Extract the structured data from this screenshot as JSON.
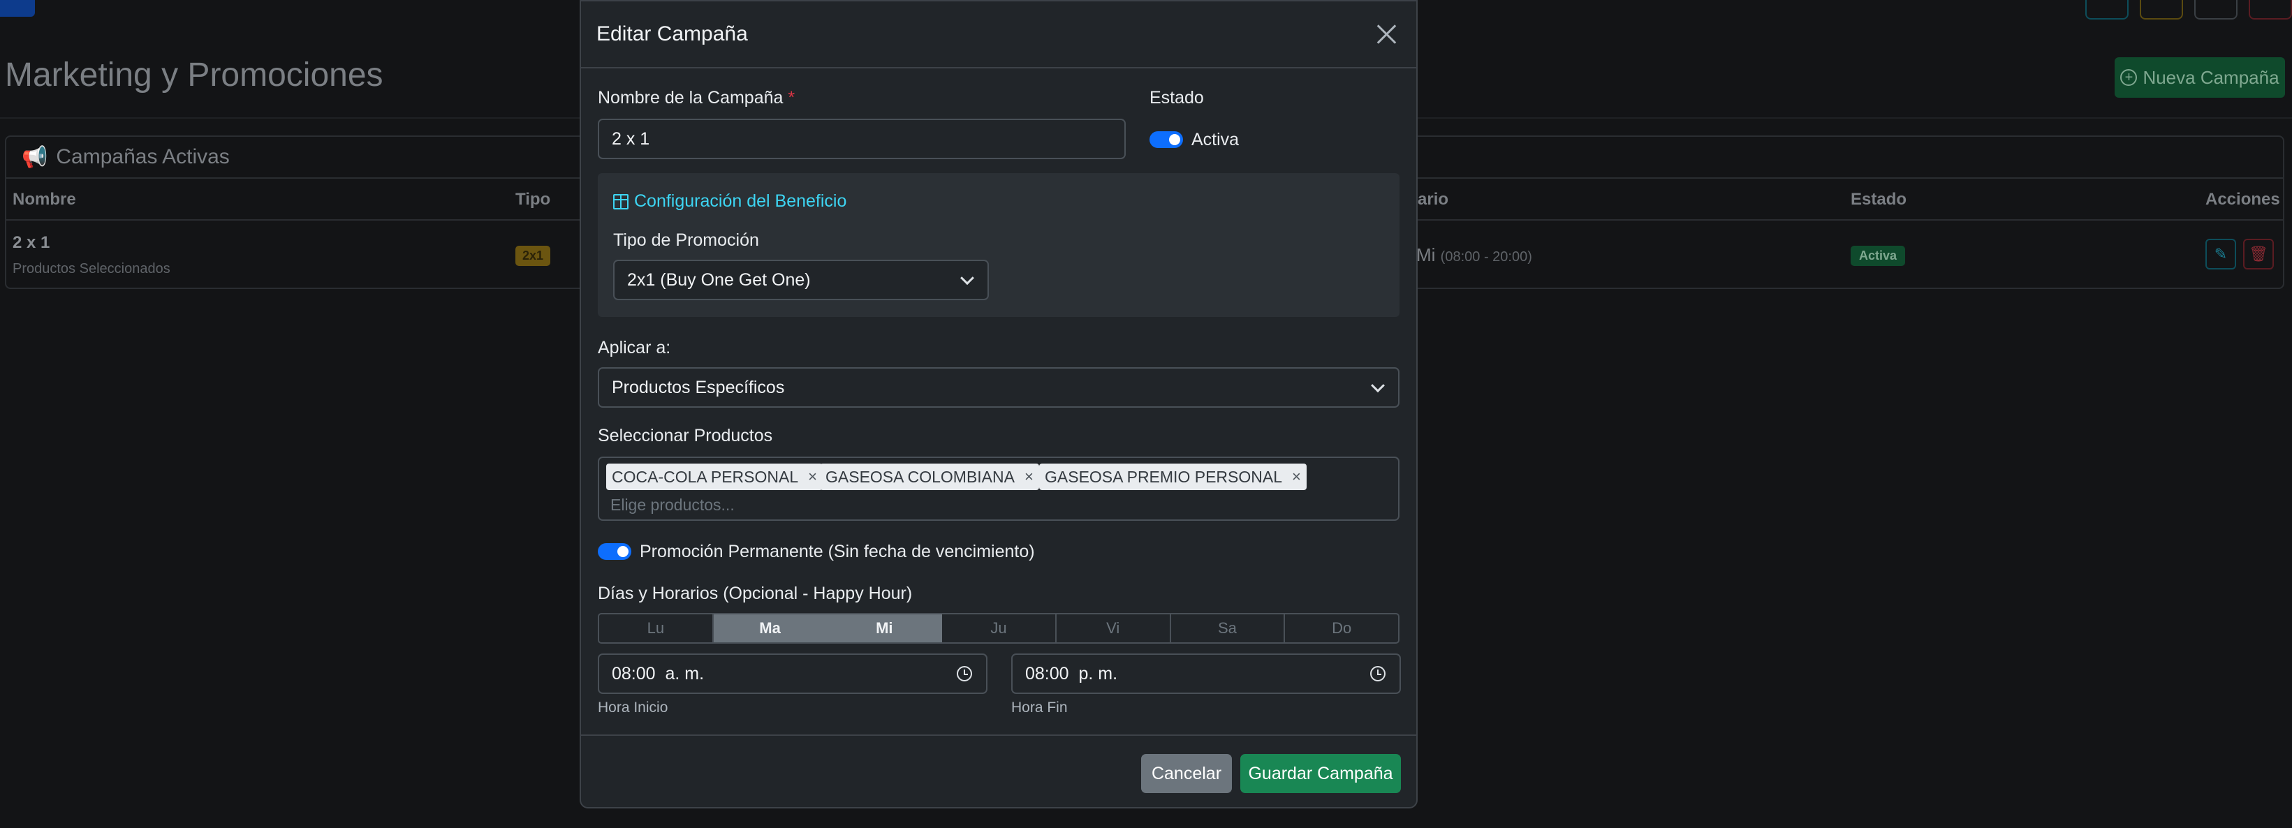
{
  "background": {
    "title": "Marketing y Promociones",
    "new_campaign_label": "Nueva Campaña",
    "card_title": "Campañas Activas",
    "table": {
      "headers": {
        "nombre": "Nombre",
        "tipo": "Tipo",
        "horario": "ario",
        "estado": "Estado",
        "acciones": "Acciones"
      },
      "row": {
        "name": "2 x 1",
        "sub": "Productos Seleccionados",
        "type_badge": "2x1",
        "horario_days": "Mi",
        "horario_time": "(08:00 - 20:00)",
        "status": "Activa"
      }
    }
  },
  "modal": {
    "title": "Editar Campaña",
    "name_label": "Nombre de la Campaña",
    "required_mark": "*",
    "name_value": "2 x 1",
    "estado_label": "Estado",
    "estado_value": "Activa",
    "estado_on": true,
    "benefit_title": "Configuración del Beneficio",
    "promo_type_label": "Tipo de Promoción",
    "promo_type_value": "2x1 (Buy One Get One)",
    "apply_label": "Aplicar a:",
    "apply_value": "Productos Específicos",
    "products_label": "Seleccionar Productos",
    "products": [
      "COCA-COLA PERSONAL",
      "GASEOSA COLOMBIANA",
      "GASEOSA PREMIO PERSONAL"
    ],
    "products_placeholder": "Elige productos...",
    "permanent_label": "Promoción Permanente (Sin fecha de vencimiento)",
    "permanent_on": true,
    "schedule_label": "Días y Horarios (Opcional - Happy Hour)",
    "days": [
      {
        "label": "Lu",
        "active": false
      },
      {
        "label": "Ma",
        "active": true
      },
      {
        "label": "Mi",
        "active": true
      },
      {
        "label": "Ju",
        "active": false
      },
      {
        "label": "Vi",
        "active": false
      },
      {
        "label": "Sa",
        "active": false
      },
      {
        "label": "Do",
        "active": false
      }
    ],
    "start_time": "08:00  a. m.",
    "start_label": "Hora Inicio",
    "end_time": "08:00  p. m.",
    "end_label": "Hora Fin",
    "cancel_label": "Cancelar",
    "save_label": "Guardar Campaña"
  },
  "colors": {
    "accent": "#0d6efd",
    "info": "#3dd5f3",
    "success": "#198754",
    "secondary": "#6c757d",
    "danger": "#dc3545"
  }
}
